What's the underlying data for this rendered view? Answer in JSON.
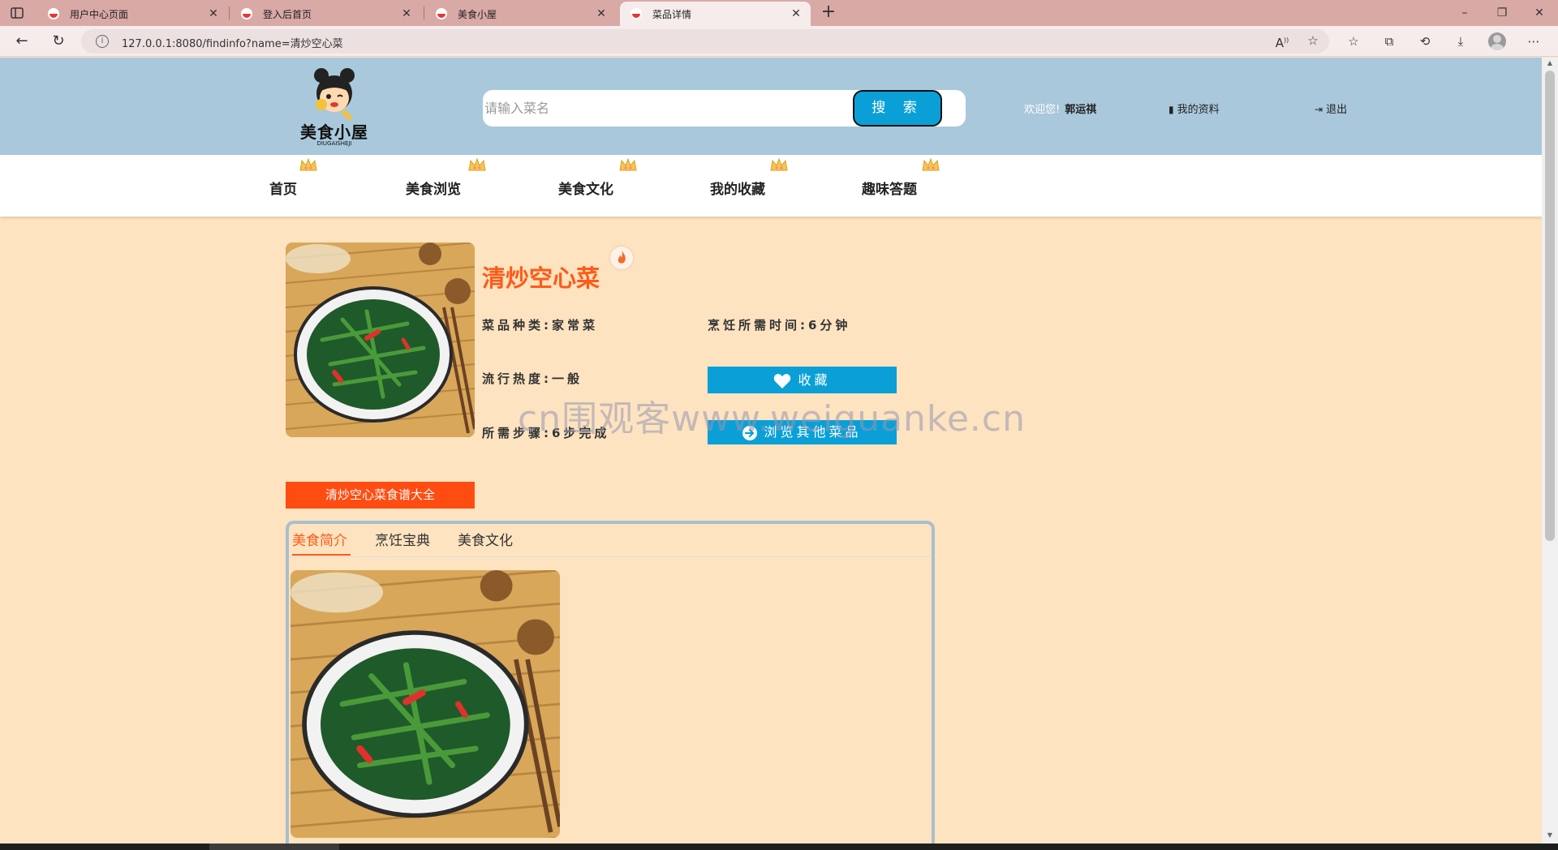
{
  "browser": {
    "tabs": [
      {
        "label": "用户中心页面",
        "active": false
      },
      {
        "label": "登入后首页",
        "active": false
      },
      {
        "label": "美食小屋",
        "active": false
      },
      {
        "label": "菜品详情",
        "active": true
      }
    ],
    "url": "127.0.0.1:8080/findinfo?name=清炒空心菜",
    "new_tab": "+",
    "minimize": "–",
    "restore": "❐",
    "close": "✕"
  },
  "header": {
    "logo_text": "美食小屋",
    "logo_sub": "DIUGAISHEJI",
    "search_placeholder": "请输入菜名",
    "search_button": "搜 索",
    "welcome_label": "欢迎您!",
    "username": "郭运祺",
    "my_profile": "我的资料",
    "logout": "退出"
  },
  "nav": {
    "items": [
      "首页",
      "美食浏览",
      "美食文化",
      "我的收藏",
      "趣味答题"
    ]
  },
  "dish": {
    "title": "清炒空心菜",
    "category": "菜品种类:家常菜",
    "cook_time": "烹饪所需时间:6分钟",
    "popularity": "流行热度:一般",
    "steps": "所需步骤:6步完成",
    "favorite_button": "收藏",
    "browse_button": "浏览其他菜品"
  },
  "watermark": "cn围观客www.weiguanke.cn",
  "recipe_button": "清炒空心菜食谱大全",
  "content_tabs": [
    {
      "label": "美食简介",
      "active": true
    },
    {
      "label": "烹饪宝典",
      "active": false
    },
    {
      "label": "美食文化",
      "active": false
    }
  ],
  "colors": {
    "page_bg": "#fde3c0",
    "header_bg": "#a9c8dc",
    "accent_orange": "#ff5a18",
    "accent_blue": "#0aa0d7"
  }
}
